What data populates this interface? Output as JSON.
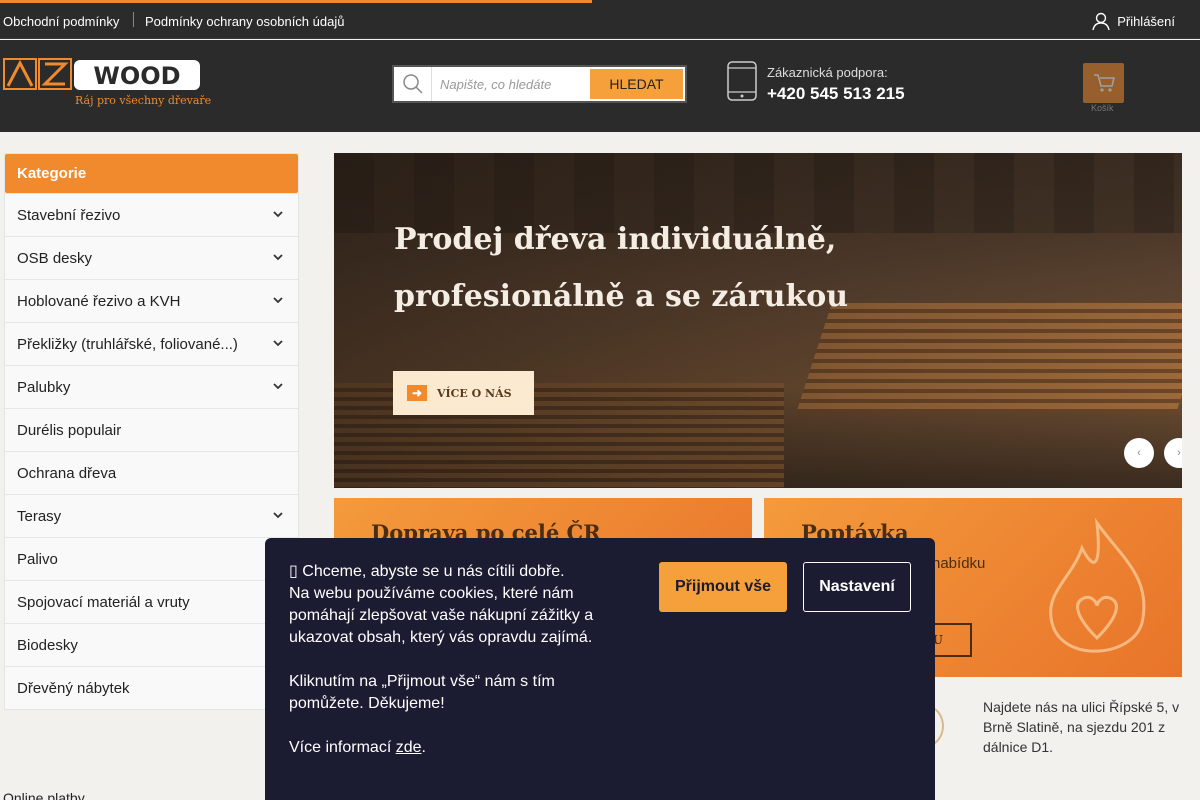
{
  "topbar": {
    "links": [
      "Obchodní podmínky",
      "Podmínky ochrany osobních údajů"
    ],
    "login_label": "Přihlášení"
  },
  "header": {
    "logo_sub": "Ráj pro všechny dřevaře",
    "search_placeholder": "Napište, co hledáte",
    "search_button": "HLEDAT",
    "support_label": "Zákaznická podpora:",
    "support_phone": "+420 545 513 215",
    "cart_label": "Košík"
  },
  "sidebar": {
    "title": "Kategorie",
    "items": [
      {
        "label": "Stavební řezivo",
        "has_submenu": true
      },
      {
        "label": "OSB desky",
        "has_submenu": true
      },
      {
        "label": "Hoblované řezivo a KVH",
        "has_submenu": true
      },
      {
        "label": "Překližky (truhlářské, foliované...)",
        "has_submenu": true
      },
      {
        "label": "Palubky",
        "has_submenu": true
      },
      {
        "label": "Durélis populair",
        "has_submenu": false
      },
      {
        "label": "Ochrana dřeva",
        "has_submenu": false
      },
      {
        "label": "Terasy",
        "has_submenu": true
      },
      {
        "label": "Palivo",
        "has_submenu": false
      },
      {
        "label": "Spojovací materiál a vruty",
        "has_submenu": false
      },
      {
        "label": "Biodesky",
        "has_submenu": false
      },
      {
        "label": "Dřevěný nábytek",
        "has_submenu": false
      }
    ]
  },
  "banner": {
    "headline": "Prodej dřeva individuálně, profesionálně a se zárukou",
    "button": "VÍCE O NÁS"
  },
  "cards": [
    {
      "title": "Doprava po celé ČR",
      "subtitle": "",
      "button": ""
    },
    {
      "title": "Poptávka",
      "subtitle": "nabídku",
      "button": "VKU"
    }
  ],
  "address": "Najdete nás na ulici Řípské 5, v Brně Slatině, na sjezdu 201 z dálnice D1.",
  "footer": {
    "online_payments": "Online platby"
  },
  "cookie": {
    "line1": "Chceme, abyste se u nás cítili dobře.",
    "line2": "Na webu používáme cookies, které nám pomáhají zlepšovat vaše nákupní zážitky a ukazovat obsah, který vás opravdu zajímá.",
    "line3": "Kliknutím na „Přijmout vše“ nám s tím pomůžete. Děkujeme!",
    "more_prefix": "Více informací ",
    "more_link": "zde",
    "more_suffix": ".",
    "accept": "Přijmout vše",
    "settings": "Nastavení"
  },
  "colors": {
    "accent": "#f08a2c",
    "dark": "#2b2b2b",
    "cookie_bg": "#1b1b32"
  }
}
